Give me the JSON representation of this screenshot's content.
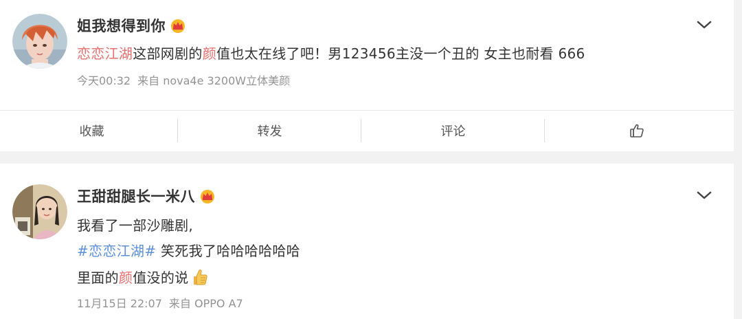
{
  "post1": {
    "username": "姐我想得到你",
    "content": {
      "tag": "恋恋江湖",
      "part1": "这部网剧的",
      "highlight": "颜",
      "part2": "值也太在线了吧！男123456主没一个丑的 女主也耐看 666"
    },
    "time": "今天00:32",
    "source": "来自 nova4e 3200W立体美颜"
  },
  "actions": {
    "favorite": "收藏",
    "repost": "转发",
    "comment": "评论"
  },
  "post2": {
    "username": "王甜甜腿长一米八",
    "line1": "我看了一部沙雕剧,",
    "hashtag": "#恋恋江湖#",
    "line2_rest": " 笑死我了哈哈哈哈哈哈",
    "line3_part1": "里面的",
    "line3_highlight": "颜",
    "line3_part2": "值没的说",
    "time": "11月15日 22:07",
    "source": "来自 OPPO A7"
  },
  "colors": {
    "accent_pink": "#e86f6c",
    "hashtag_blue": "#5b90d8",
    "meta_gray": "#939393",
    "crown_gold": "#f6b626"
  },
  "icons": [
    "crown-icon",
    "chevron-down-icon",
    "thumbs-up-icon",
    "thumbs-up-emoji-icon"
  ]
}
